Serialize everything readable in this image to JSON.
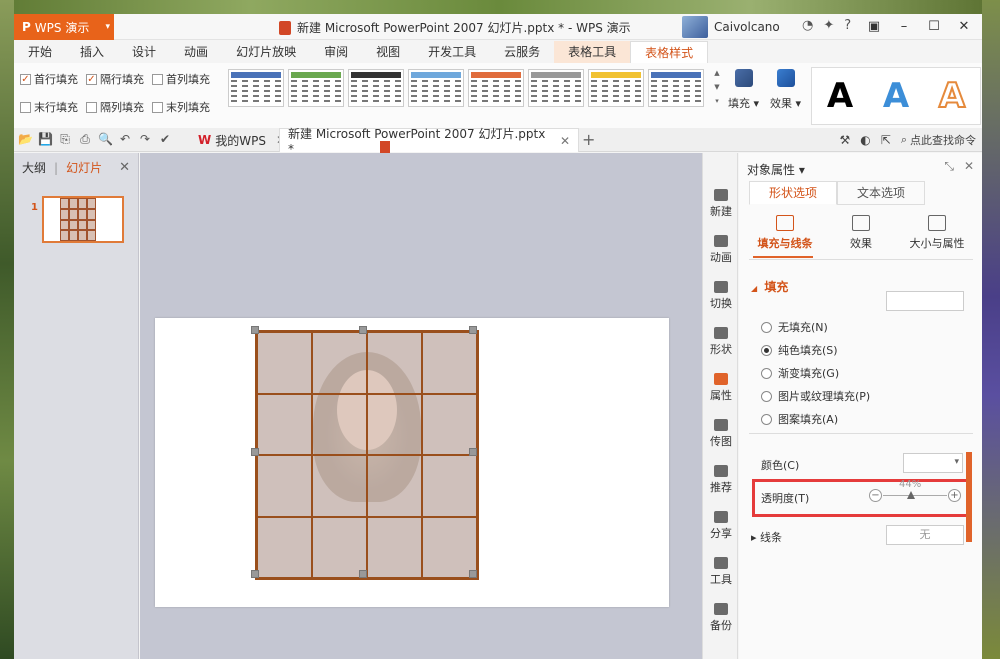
{
  "app": {
    "name": "WPS 演示",
    "logo": "P"
  },
  "window_title": "新建 Microsoft PowerPoint 2007 幻灯片.pptx * - WPS 演示",
  "user": {
    "name": "Caivolcano"
  },
  "ribbon_tabs": [
    "开始",
    "插入",
    "设计",
    "动画",
    "幻灯片放映",
    "审阅",
    "视图",
    "开发工具",
    "云服务",
    "表格工具",
    "表格样式"
  ],
  "ribbon": {
    "checkboxes": [
      {
        "label": "首行填充",
        "checked": true
      },
      {
        "label": "隔行填充",
        "checked": true
      },
      {
        "label": "首列填充",
        "checked": false
      },
      {
        "label": "末行填充",
        "checked": false
      },
      {
        "label": "隔列填充",
        "checked": false
      },
      {
        "label": "末列填充",
        "checked": false
      }
    ],
    "style_colors": [
      "#4a72b8",
      "#6aa84f",
      "#333333",
      "#6fa8dc",
      "#e06c3c",
      "#999999",
      "#f1c232",
      "#4a72b8"
    ],
    "fill_label": "填充 ▾",
    "effect_label": "效果 ▾",
    "wordart": [
      "A",
      "A",
      "A"
    ]
  },
  "doc_tabs": {
    "wps_tab": "我的WPS",
    "current": "新建 Microsoft PowerPoint 2007 幻灯片.pptx *",
    "search": "点此查找命令"
  },
  "left_panel": {
    "tabs": [
      "大纲",
      "幻灯片"
    ],
    "slide_number": "1"
  },
  "sidebar_items": [
    "新建",
    "动画",
    "切换",
    "形状",
    "属性",
    "传图",
    "推荐",
    "分享",
    "工具",
    "备份"
  ],
  "properties": {
    "header": "对象属性 ▾",
    "tabs": [
      "形状选项",
      "文本选项"
    ],
    "subtabs": [
      "填充与线条",
      "效果",
      "大小与属性"
    ],
    "fill_section": "填充",
    "fill_options": [
      {
        "label": "无填充(N)",
        "selected": false
      },
      {
        "label": "纯色填充(S)",
        "selected": true
      },
      {
        "label": "渐变填充(G)",
        "selected": false
      },
      {
        "label": "图片或纹理填充(P)",
        "selected": false
      },
      {
        "label": "图案填充(A)",
        "selected": false
      }
    ],
    "color_label": "颜色(C)",
    "transparency_label": "透明度(T)",
    "transparency_value": "44%",
    "transparency_fraction": 0.44,
    "line_label": "线条",
    "line_value": "无"
  }
}
